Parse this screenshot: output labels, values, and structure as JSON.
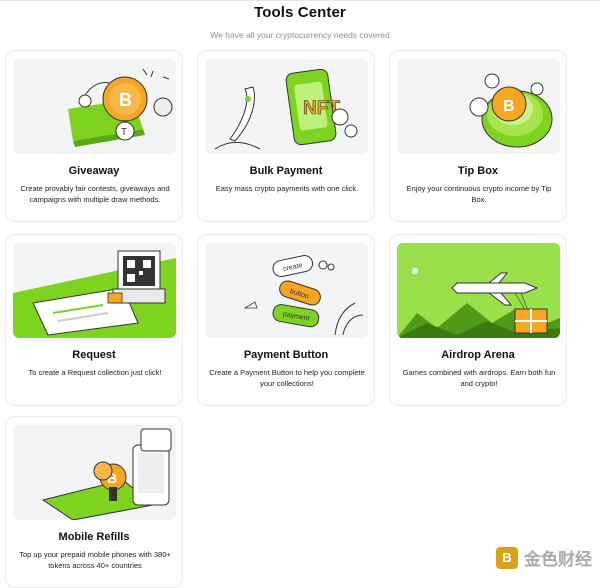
{
  "header": {
    "title": "Tools Center",
    "subtitle": "We have all your cryptocurrency needs covered"
  },
  "cards": [
    {
      "title": "Giveaway",
      "description": "Create provably fair contests, giveaways and campaigns with multiple draw methods."
    },
    {
      "title": "Bulk Payment",
      "description": "Easy mass crypto payments with one click."
    },
    {
      "title": "Tip Box",
      "description": "Enjoy your continuous crypto income by Tip Box."
    },
    {
      "title": "Request",
      "description": "To create a Request collection just click!"
    },
    {
      "title": "Payment Button",
      "description": "Create a Payment Button to help you complete your collections!"
    },
    {
      "title": "Airdrop Arena",
      "description": "Games combined with airdrops. Earn both fun and crypto!"
    },
    {
      "title": "Mobile Refills",
      "description": "Top up your prepaid mobile phones with 380+ tokens across 40+ countries"
    }
  ],
  "illustrations": {
    "nft_text": "NFT",
    "pill_labels": [
      "create",
      "button",
      "payment"
    ]
  },
  "watermark": {
    "text": "金色财经",
    "logo_glyph": "B"
  },
  "colors": {
    "accent_green": "#7ed321",
    "coin_orange": "#f5a623",
    "card_border": "#ececec"
  }
}
